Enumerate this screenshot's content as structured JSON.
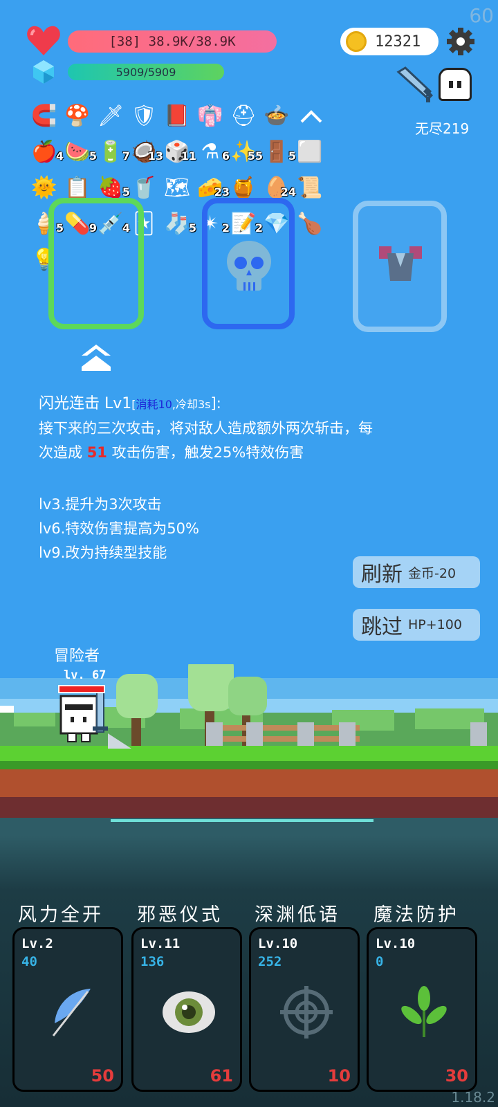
{
  "status": {
    "fps": "60",
    "hp_text": "[38] 38.9K/38.9K",
    "mp_text": "5909/5909",
    "coins": "12321",
    "mode_label": "无尽219"
  },
  "items": [
    {
      "icon": "magnet-icon",
      "glyph": "🧲",
      "count": ""
    },
    {
      "icon": "mushroom-icon",
      "glyph": "🍄",
      "count": ""
    },
    {
      "icon": "sword-icon",
      "glyph": "🗡",
      "count": ""
    },
    {
      "icon": "shield-icon",
      "glyph": "🛡",
      "count": ""
    },
    {
      "icon": "skull-book-icon",
      "glyph": "📕",
      "count": ""
    },
    {
      "icon": "robe-icon",
      "glyph": "👘",
      "count": ""
    },
    {
      "icon": "viking-helmet-icon",
      "glyph": "⛑",
      "count": ""
    },
    {
      "icon": "cauldron-icon",
      "glyph": "🍲",
      "count": ""
    },
    {
      "icon": "apple-icon",
      "glyph": "🍎",
      "count": "4"
    },
    {
      "icon": "watermelon-icon",
      "glyph": "🍉",
      "count": "5"
    },
    {
      "icon": "battery-icon",
      "glyph": "🔋",
      "count": "7"
    },
    {
      "icon": "coconut-icon",
      "glyph": "🥥",
      "count": "13"
    },
    {
      "icon": "dice-icon",
      "glyph": "🎲",
      "count": "11"
    },
    {
      "icon": "potion-icon",
      "glyph": "⚗",
      "count": "6"
    },
    {
      "icon": "dots-icon",
      "glyph": "✨",
      "count": "55"
    },
    {
      "icon": "door-icon",
      "glyph": "🚪",
      "count": "5"
    },
    {
      "icon": "ice-block-icon",
      "glyph": "⬜",
      "count": ""
    },
    {
      "icon": "sun-icon",
      "glyph": "🌞",
      "count": ""
    },
    {
      "icon": "list-icon",
      "glyph": "📋",
      "count": ""
    },
    {
      "icon": "strawberry-icon",
      "glyph": "🍓",
      "count": "5"
    },
    {
      "icon": "drink-icon",
      "glyph": "🥤",
      "count": ""
    },
    {
      "icon": "map-icon",
      "glyph": "🗺",
      "count": ""
    },
    {
      "icon": "cheese-icon",
      "glyph": "🧀",
      "count": "23"
    },
    {
      "icon": "jam-icon",
      "glyph": "🍯",
      "count": ""
    },
    {
      "icon": "gold-egg-icon",
      "glyph": "🥚",
      "count": "24"
    },
    {
      "icon": "scroll-icon",
      "glyph": "📜",
      "count": ""
    },
    {
      "icon": "ice-cream-icon",
      "glyph": "🍦",
      "count": "5"
    },
    {
      "icon": "pill-icon",
      "glyph": "💊",
      "count": "9"
    },
    {
      "icon": "syringe-icon",
      "glyph": "💉",
      "count": "4"
    },
    {
      "icon": "cards-icon",
      "glyph": "🃏",
      "count": ""
    },
    {
      "icon": "sock-icon",
      "glyph": "🧦",
      "count": "5"
    },
    {
      "icon": "mace-icon",
      "glyph": "✴",
      "count": "2"
    },
    {
      "icon": "note-icon",
      "glyph": "📝",
      "count": "2"
    },
    {
      "icon": "ruby-icon",
      "glyph": "💎",
      "count": ""
    },
    {
      "icon": "drumstick-icon",
      "glyph": "🍗",
      "count": ""
    },
    {
      "icon": "lightbulb-icon",
      "glyph": "💡",
      "count": ""
    }
  ],
  "description": {
    "title": "闪光连击 Lv1",
    "bracket_open": "[",
    "cost": "消耗10",
    "comma": ",",
    "cooldown": "冷却3s",
    "bracket_close": "]:",
    "line1": "接下来的三次攻击，将对敌人造成额外两次斩击，每",
    "line2_pre": "次造成 ",
    "line2_dmg": "51",
    "line2_post": " 攻击伤害，触发25%特效伤害",
    "lv3": "lv3.提升为3次攻击",
    "lv6": "lv6.特效伤害提高为50%",
    "lv9": "lv9.改为持续型技能"
  },
  "buttons": {
    "refresh": "刷新",
    "refresh_cost": "金币-20",
    "skip": "跳过",
    "skip_reward": "HP+100"
  },
  "hero": {
    "name": "冒险者",
    "level": "lv. 67"
  },
  "skills": [
    {
      "title": "风力全开",
      "lv": "Lv.2",
      "value": "40",
      "cost": "50",
      "icon": "feather-icon"
    },
    {
      "title": "邪恶仪式",
      "lv": "Lv.11",
      "value": "136",
      "cost": "61",
      "icon": "eye-icon"
    },
    {
      "title": "深渊低语",
      "lv": "Lv.10",
      "value": "252",
      "cost": "10",
      "icon": "crosshair-icon"
    },
    {
      "title": "魔法防护",
      "lv": "Lv.10",
      "value": "0",
      "cost": "30",
      "icon": "leaf-icon"
    }
  ],
  "version": "1.18.2"
}
